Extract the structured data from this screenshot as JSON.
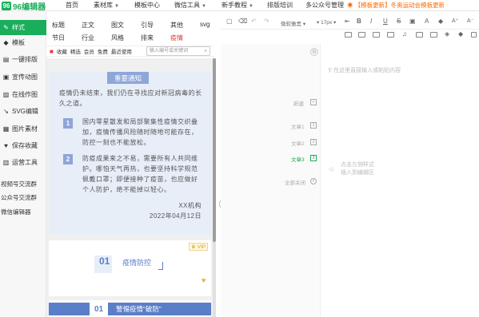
{
  "app": {
    "logo_mark": "96",
    "logo_text": "96编辑器"
  },
  "nav": {
    "home": "首页",
    "material": "素材库",
    "templates": "模板中心",
    "wechat_tools": "微信工具",
    "tutorial": "新手教程",
    "training": "排版培训",
    "multi_account": "多公众号管理",
    "promo": "【模板更新】冬奥运动会模板更新"
  },
  "sidebar": {
    "items": [
      {
        "label": "样式",
        "icon": "✎"
      },
      {
        "label": "模板",
        "icon": "◆"
      },
      {
        "label": "一键排版",
        "icon": "▤"
      },
      {
        "label": "宣传动图",
        "icon": "▣"
      },
      {
        "label": "在线作图",
        "icon": "▨"
      },
      {
        "label": "SVG编辑",
        "icon": "↘"
      },
      {
        "label": "图片素材",
        "icon": "▦"
      },
      {
        "label": "保存收藏",
        "icon": "♥"
      },
      {
        "label": "运营工具",
        "icon": "▥"
      },
      {
        "label": "视频号交流群",
        "icon": ""
      },
      {
        "label": "公众号交流群",
        "icon": ""
      },
      {
        "label": "微信编辑器",
        "icon": ""
      }
    ]
  },
  "categories": {
    "row1": [
      "标题",
      "正文",
      "图文",
      "引导",
      "其他",
      "svg"
    ],
    "row2": [
      "节日",
      "行业",
      "风格",
      "排来",
      "疫情"
    ]
  },
  "filter": {
    "items": [
      "收藏",
      "精选",
      "会员",
      "免费",
      "最近使用"
    ],
    "search_placeholder": "输入编号或关键词"
  },
  "notice": {
    "title": "重要通知",
    "intro": "疫情仍未结束，我们仍在寻找应对新冠病毒的长久之道。",
    "item1_num": "1",
    "item1": "国内零星散发和局部聚集性疫情交织叠加，疫情传播风险随时随地可能存在，防控一刻也不能放松。",
    "item2_num": "2",
    "item2": "防疫成果来之不易，需要所有人共同维护。哪怕天气再热，也要坚持科学规范佩戴口罩；即便接种了疫苗，也应做好个人防护，绝不能掉以轻心。",
    "org": "XX机构",
    "date": "2022年04月12日"
  },
  "card2": {
    "vip": "VIP",
    "num": "01",
    "title": "疫情防控"
  },
  "card3": {
    "num": "01",
    "title": "警惕疫情“破防”"
  },
  "editor": {
    "font_family": "微软雅黑",
    "font_size": "17px",
    "placeholder": "在这里直接输入或粘贴内容",
    "side_labels": [
      "新建",
      "文章1",
      "文章2",
      "文章3",
      "全部关闭"
    ],
    "hint_line1": "点击左侧样式",
    "hint_line2": "插入到编辑区"
  },
  "colors": {
    "brand_green": "#1aad5a",
    "notice_blue": "#8ea6d8",
    "card_bg": "#e7eef8",
    "promo_orange": "#ff6a00",
    "accent_red": "#e53935"
  }
}
